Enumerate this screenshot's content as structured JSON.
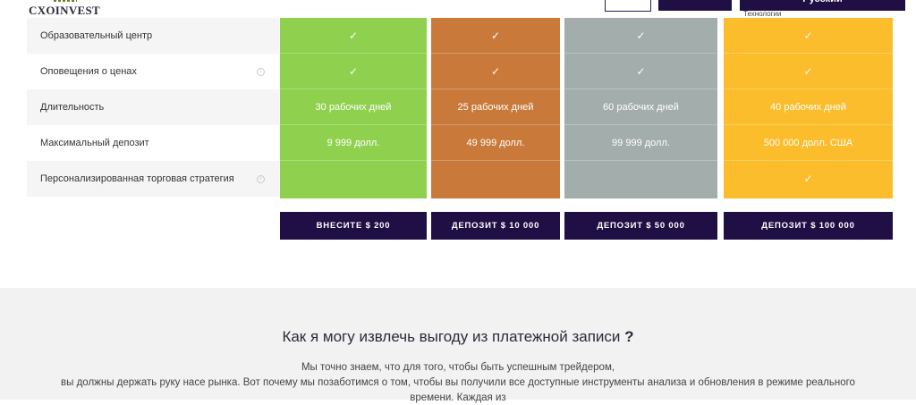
{
  "header": {
    "logo_text": "CXOINVEST",
    "language": "Русский",
    "tech_label": "Технологии"
  },
  "colors": {
    "green": "#8fd14f",
    "bronze": "#c97a3a",
    "gray": "#a3adab",
    "gold": "#fbbd2c",
    "button_dark": "#1f0f45",
    "section_bg": "#f2f2f2"
  },
  "features": [
    {
      "label": "Образовательный центр",
      "info": false
    },
    {
      "label": "Оповещения о ценах",
      "info": true
    },
    {
      "label": "Длительность",
      "info": false
    },
    {
      "label": "Максимальный депозит",
      "info": false
    },
    {
      "label": "Персонализированная торговая стратегия",
      "info": true
    }
  ],
  "check_icon": "checkmark-icon",
  "plans": [
    {
      "color": "#8fd14f",
      "values": [
        "✓",
        "✓",
        "30 рабочих дней",
        "9 999 долл.",
        ""
      ],
      "button": "ВНЕСИТЕ $ 200"
    },
    {
      "color": "#c97a3a",
      "values": [
        "✓",
        "✓",
        "25 рабочих дней",
        "49 999 долл.",
        ""
      ],
      "button": "ДЕПОЗИТ $ 10 000"
    },
    {
      "color": "#a3adab",
      "values": [
        "✓",
        "✓",
        "60 рабочих дней",
        "99 999 долл.",
        ""
      ],
      "button": "ДЕПОЗИТ $ 50 000"
    },
    {
      "color": "#fbbd2c",
      "values": [
        "✓",
        "✓",
        "40 рабочих дней",
        "500 000 долл. США",
        "✓"
      ],
      "button": "ДЕПОЗИТ $ 100 000"
    }
  ],
  "benefit": {
    "title": "Как я могу извлечь выгоду из платежной записи",
    "title_mark": "?",
    "line1": "Мы точно знаем, что для того, чтобы быть успешным трейдером,",
    "line2": "вы должны держать руку насе рынка. Вот почему мы позаботимся о том, чтобы вы получили все доступные инструменты анализа и обновления в режиме реального",
    "line3": "времени. Каждая из"
  }
}
